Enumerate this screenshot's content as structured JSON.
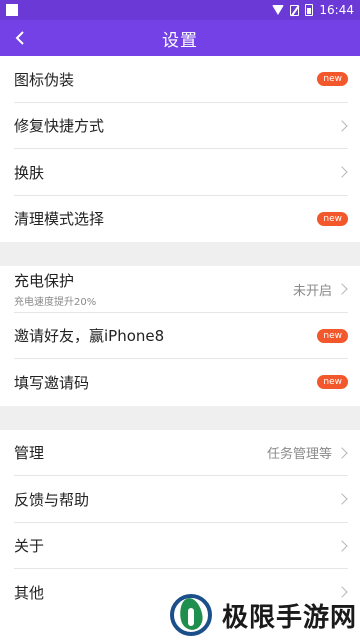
{
  "status_bar": {
    "time": "16:44"
  },
  "header": {
    "title": "设置"
  },
  "section1": [
    {
      "label": "图标伪装",
      "badge": "new"
    },
    {
      "label": "修复快捷方式"
    },
    {
      "label": "换肤"
    },
    {
      "label": "清理模式选择",
      "badge": "new"
    }
  ],
  "section2": {
    "charge": {
      "label": "充电保护",
      "sub": "充电速度提升20%",
      "value": "未开启"
    },
    "invite": {
      "label": "邀请好友，赢iPhone8",
      "badge": "new"
    },
    "code": {
      "label": "填写邀请码",
      "badge": "new"
    }
  },
  "section3": [
    {
      "label": "管理",
      "value": "任务管理等"
    },
    {
      "label": "反馈与帮助"
    },
    {
      "label": "关于"
    },
    {
      "label": "其他"
    }
  ],
  "watermark": {
    "text": "极限手游网"
  },
  "colors": {
    "appbar": "#7341e6",
    "statusbar": "#6a39d6",
    "badge": "#f2582b"
  }
}
